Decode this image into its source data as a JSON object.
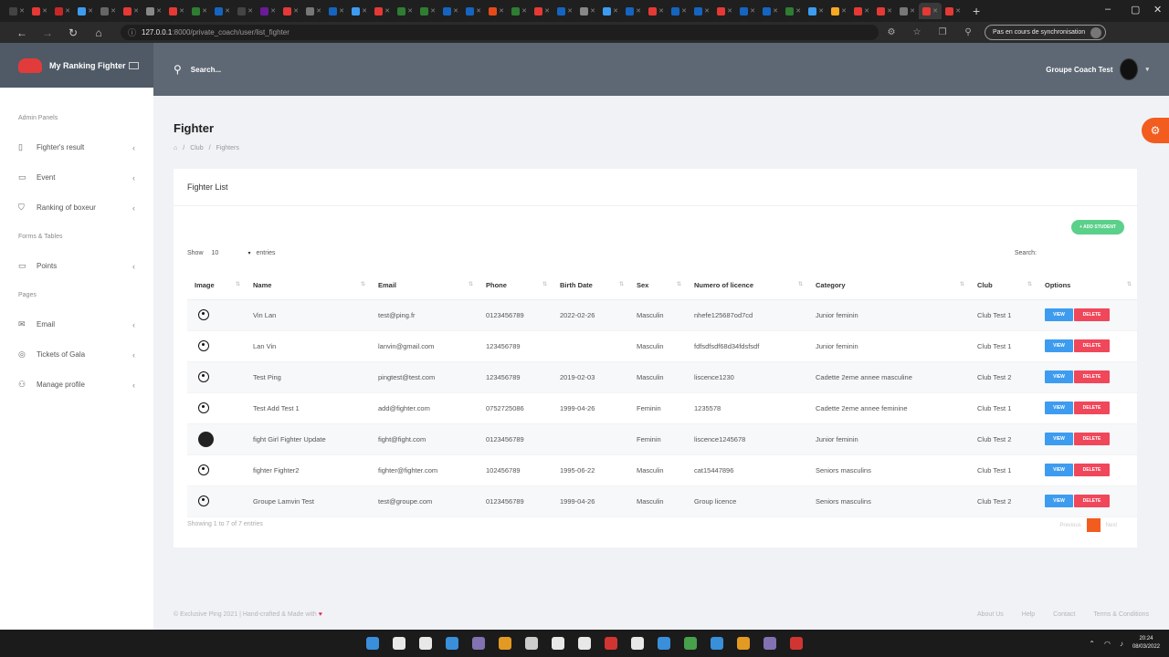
{
  "browser": {
    "tab_colors": [
      "#444444",
      "#e53935",
      "#c62828",
      "#3d9cf0",
      "#666666",
      "#e53935",
      "#888888",
      "#e53935",
      "#2e7d32",
      "#1565c0",
      "#444444",
      "#6a1b9a",
      "#e53935",
      "#777777",
      "#1565c0",
      "#3d9cf0",
      "#e53935",
      "#2e7d32",
      "#2e7d32",
      "#1565c0",
      "#1565c0",
      "#e64a19",
      "#2e7d32",
      "#e53935",
      "#1565c0",
      "#888888",
      "#3d9cf0",
      "#1565c0",
      "#e53935",
      "#1565c0",
      "#1565c0",
      "#e53935",
      "#1565c0",
      "#1565c0",
      "#2e7d32",
      "#3d9cf0",
      "#f9a825",
      "#e53935",
      "#e53935",
      "#777777",
      "#e53935",
      "#e53935"
    ],
    "url_host": "127.0.0.1",
    "url_path": ":8000/private_coach/user/list_fighter",
    "sync_label": "Pas en cours de synchronisation"
  },
  "app": {
    "brand": "My Ranking Fighter",
    "search_placeholder": "Search...",
    "user_name": "Groupe Coach Test"
  },
  "sidebar": {
    "sections": [
      {
        "title": "Admin Panels",
        "items": [
          {
            "label": "Fighter's result",
            "icon": "file-icon"
          },
          {
            "label": "Event",
            "icon": "clipboard-icon"
          },
          {
            "label": "Ranking of boxeur",
            "icon": "shield-icon"
          }
        ]
      },
      {
        "title": "Forms & Tables",
        "items": [
          {
            "label": "Points",
            "icon": "clipboard-icon"
          }
        ]
      },
      {
        "title": "Pages",
        "items": [
          {
            "label": "Email",
            "icon": "mail-icon"
          },
          {
            "label": "Tickets of Gala",
            "icon": "ticket-icon"
          },
          {
            "label": "Manage profile",
            "icon": "users-icon"
          }
        ]
      }
    ]
  },
  "page": {
    "title": "Fighter",
    "breadcrumb": [
      "Club",
      "Fighters"
    ]
  },
  "card": {
    "title": "Fighter List",
    "add_button": "+ ADD STUDENT",
    "show_label": "Show",
    "show_value": "10",
    "entries_label": "entries",
    "search_label": "Search:",
    "info": "Showing 1 to 7 of 7 entries",
    "prev": "Previous",
    "page": "1",
    "next": "Next"
  },
  "table": {
    "columns": [
      "Image",
      "Name",
      "Email",
      "Phone",
      "Birth Date",
      "Sex",
      "Numero of licence",
      "Category",
      "Club",
      "Options"
    ],
    "view_label": "VIEW",
    "delete_label": "DELETE",
    "rows": [
      {
        "avatar": "default",
        "name": "Vin Lan",
        "email": "test@ping.fr",
        "phone": "0123456789",
        "birth": "2022-02-26",
        "sex": "Masculin",
        "licence": "nhefe125687od7cd",
        "category": "Junior feminin",
        "club": "Club Test 1"
      },
      {
        "avatar": "default",
        "name": "Lan Vin",
        "email": "lanvin@gmail.com",
        "phone": "123456789",
        "birth": "",
        "sex": "Masculin",
        "licence": "fdfsdfsdf68d34fdsfsdf",
        "category": "Junior feminin",
        "club": "Club Test 1"
      },
      {
        "avatar": "default",
        "name": "Test Ping",
        "email": "pingtest@test.com",
        "phone": "123456789",
        "birth": "2019-02-03",
        "sex": "Masculin",
        "licence": "liscence1230",
        "category": "Cadette 2eme annee masculine",
        "club": "Club Test 2"
      },
      {
        "avatar": "default",
        "name": "Test Add Test 1",
        "email": "add@fighter.com",
        "phone": "0752725086",
        "birth": "1999-04-26",
        "sex": "Feminin",
        "licence": "1235578",
        "category": "Cadette 2eme annee feminine",
        "club": "Club Test 1"
      },
      {
        "avatar": "photo",
        "name": "fight Girl Fighter Update",
        "email": "fight@fight.com",
        "phone": "0123456789",
        "birth": "",
        "sex": "Feminin",
        "licence": "liscence1245678",
        "category": "Junior feminin",
        "club": "Club Test 2"
      },
      {
        "avatar": "default",
        "name": "fighter Fighter2",
        "email": "fighter@fighter.com",
        "phone": "102456789",
        "birth": "1995-06-22",
        "sex": "Masculin",
        "licence": "cat15447896",
        "category": "Seniors masculins",
        "club": "Club Test 1"
      },
      {
        "avatar": "default",
        "name": "Groupe Lamvin Test",
        "email": "test@groupe.com",
        "phone": "0123456789",
        "birth": "1999-04-26",
        "sex": "Masculin",
        "licence": "Group licence",
        "category": "Seniors masculins",
        "club": "Club Test 2"
      }
    ]
  },
  "footer": {
    "text": "© Exclusive Ping 2021 | Hand-crafted & Made with",
    "links": [
      "About Us",
      "Help",
      "Contact",
      "Terms & Conditions"
    ]
  },
  "taskbar": {
    "time": "20:24",
    "date": "08/03/2022",
    "icon_colors": [
      "#3d9cf0",
      "#ffffff",
      "#ffffff",
      "#3d9cf0",
      "#8e7cc3",
      "#f9a825",
      "#e0e0e0",
      "#ffffff",
      "#ffffff",
      "#e53935",
      "#ffffff",
      "#3d9cf0",
      "#4caf50",
      "#3d9cf0",
      "#f9a825",
      "#8e7cc3",
      "#e53935"
    ]
  },
  "colors": {
    "accent": "#f25c1e",
    "add": "#5ad08a",
    "view": "#3d9cf0",
    "delete": "#f0475b"
  }
}
